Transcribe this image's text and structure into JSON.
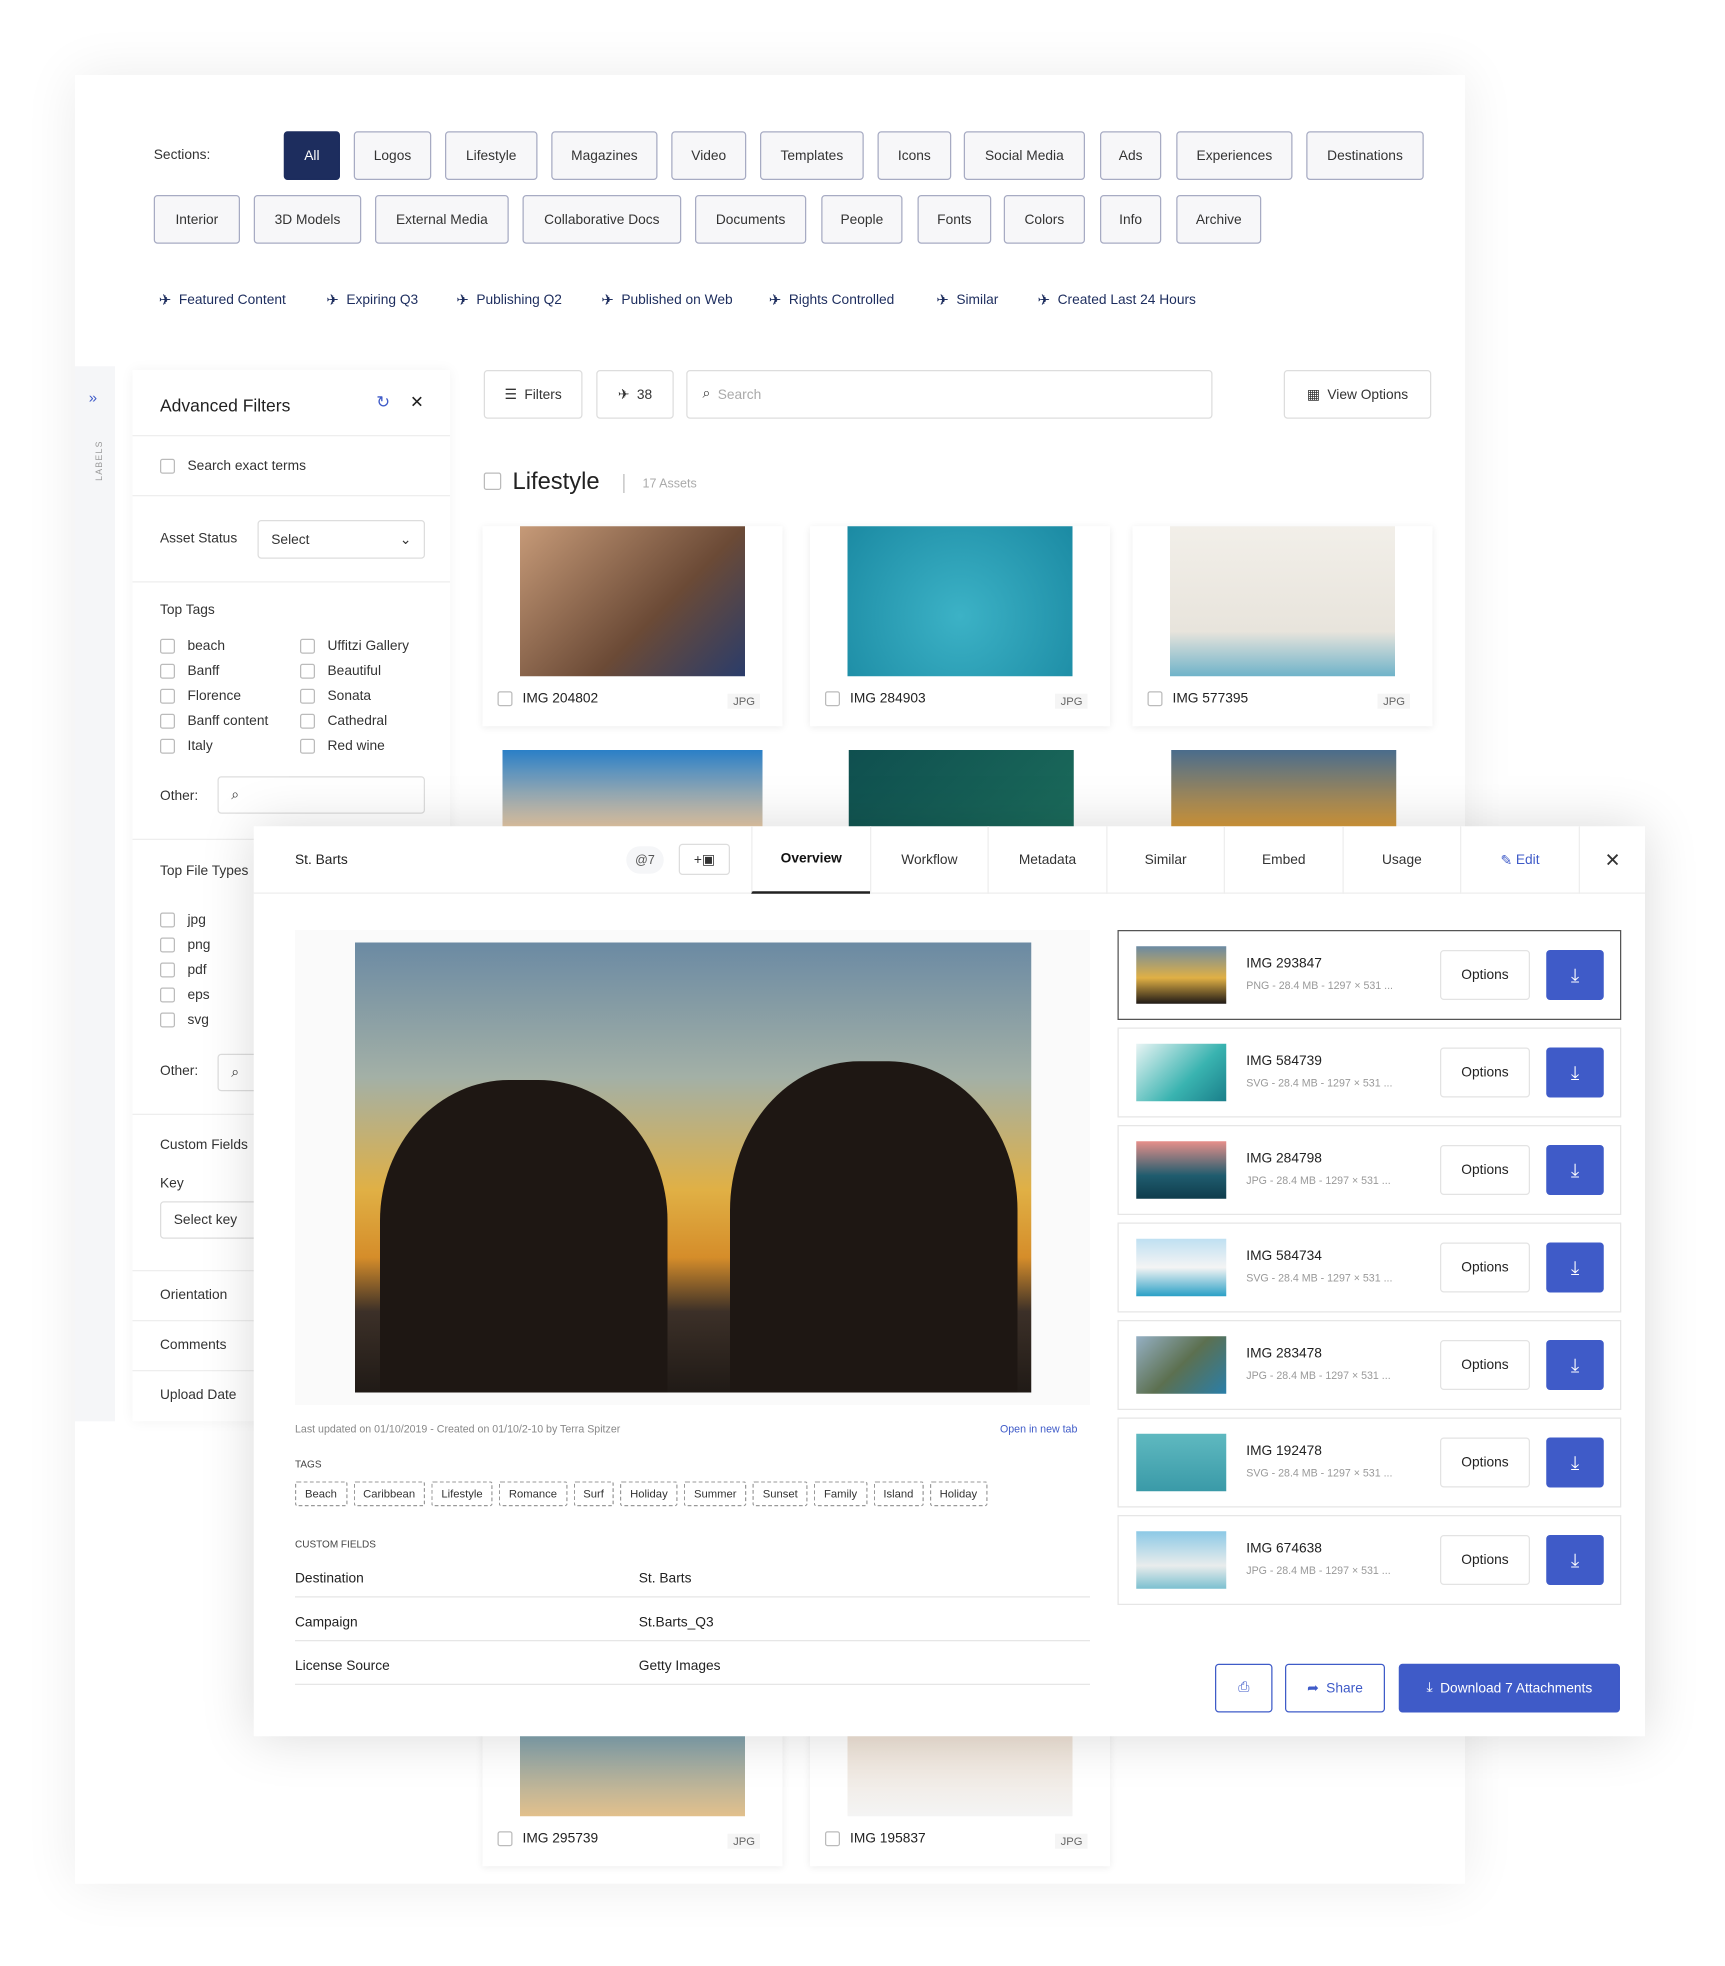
{
  "sections": {
    "label": "Sections:",
    "chips": [
      "All",
      "Logos",
      "Lifestyle",
      "Magazines",
      "Video",
      "Templates",
      "Icons",
      "Social Media",
      "Ads",
      "Experiences",
      "Destinations",
      "Interior",
      "3D Models",
      "External Media",
      "Collaborative Docs",
      "Documents",
      "People",
      "Fonts",
      "Colors",
      "Info",
      "Archive"
    ],
    "active": "All"
  },
  "pinned": [
    "Featured Content",
    "Expiring Q3",
    "Publishing Q2",
    "Published on Web",
    "Rights Controlled",
    "Similar",
    "Created Last 24 Hours"
  ],
  "rail": {
    "label": "LABELS"
  },
  "filters": {
    "title": "Advanced Filters",
    "exact": "Search exact terms",
    "asset_status": "Asset Status",
    "select": "Select",
    "top_tags": "Top Tags",
    "tags_left": [
      "beach",
      "Banff",
      "Florence",
      "Banff content",
      "Italy"
    ],
    "tags_right": [
      "Uffitzi Gallery",
      "Beautiful",
      "Sonata",
      "Cathedral",
      "Red wine"
    ],
    "other": "Other:",
    "file_types_title": "Top File Types",
    "file_types": [
      "jpg",
      "png",
      "pdf",
      "eps",
      "svg"
    ],
    "custom_fields": "Custom Fields",
    "key": "Key",
    "select_key": "Select key",
    "orientation": "Orientation",
    "comments": "Comments",
    "upload_date": "Upload Date"
  },
  "toolbar": {
    "filters": "Filters",
    "pins": "38",
    "search_placeholder": "Search",
    "view_options": "View Options"
  },
  "collection": {
    "title": "Lifestyle",
    "count": "17 Assets"
  },
  "assets": [
    {
      "name": "IMG 204802",
      "ext": "JPG"
    },
    {
      "name": "IMG 284903",
      "ext": "JPG"
    },
    {
      "name": "IMG 577395",
      "ext": "JPG"
    },
    {
      "name": "IMG 295739",
      "ext": "JPG"
    },
    {
      "name": "IMG 195837",
      "ext": "JPG"
    }
  ],
  "modal": {
    "title": "St. Barts",
    "attachments": "7",
    "tabs": [
      "Overview",
      "Workflow",
      "Metadata",
      "Similar",
      "Embed",
      "Usage"
    ],
    "active_tab": "Overview",
    "edit": "Edit",
    "meta": "Last updated on 01/10/2019  -  Created on 01/10/2-10 by Terra Spitzer",
    "open_new": "Open in new tab",
    "tags_title": "TAGS",
    "tags": [
      "Beach",
      "Caribbean",
      "Lifestyle",
      "Romance",
      "Surf",
      "Holiday",
      "Summer",
      "Sunset",
      "Family",
      "Island",
      "Holiday"
    ],
    "custom_title": "CUSTOM FIELDS",
    "custom": [
      {
        "k": "Destination",
        "v": "St. Barts"
      },
      {
        "k": "Campaign",
        "v": "St.Barts_Q3"
      },
      {
        "k": "License Source",
        "v": "Getty Images"
      }
    ],
    "items": [
      {
        "name": "IMG 293847",
        "info": "PNG  -  28.4 MB  -  1297 × 531 ..."
      },
      {
        "name": "IMG 584739",
        "info": "SVG  -  28.4 MB  -  1297 × 531 ..."
      },
      {
        "name": "IMG 284798",
        "info": "JPG  -  28.4 MB  -  1297 × 531 ..."
      },
      {
        "name": "IMG 584734",
        "info": "SVG  -  28.4 MB  -  1297 × 531 ..."
      },
      {
        "name": "IMG 283478",
        "info": "JPG  -  28.4 MB  -  1297 × 531 ..."
      },
      {
        "name": "IMG 192478",
        "info": "SVG  -  28.4 MB  -  1297 × 531 ..."
      },
      {
        "name": "IMG 674638",
        "info": "JPG  -  28.4 MB  -  1297 × 531 ..."
      }
    ],
    "options": "Options",
    "share": "Share",
    "download": "Download 7 Attachments"
  },
  "colors": {
    "navy": "#1d2d5e",
    "accent": "#3f5bc8"
  }
}
